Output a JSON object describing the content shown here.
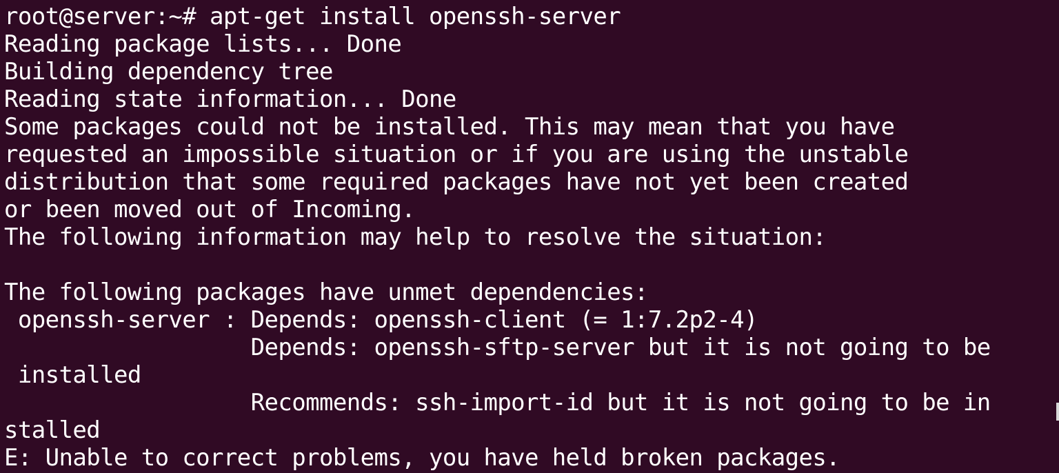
{
  "terminal": {
    "lines": [
      "root@server:~# apt-get install openssh-server",
      "Reading package lists... Done",
      "Building dependency tree",
      "Reading state information... Done",
      "Some packages could not be installed. This may mean that you have",
      "requested an impossible situation or if you are using the unstable",
      "distribution that some required packages have not yet been created",
      "or been moved out of Incoming.",
      "The following information may help to resolve the situation:",
      "",
      "The following packages have unmet dependencies:",
      " openssh-server : Depends: openssh-client (= 1:7.2p2-4)",
      "                  Depends: openssh-sftp-server but it is not going to be",
      " installed",
      "                  Recommends: ssh-import-id but it is not going to be in",
      "stalled",
      "E: Unable to correct problems, you have held broken packages."
    ]
  },
  "colors": {
    "background": "#300a24",
    "text": "#ffffff"
  }
}
